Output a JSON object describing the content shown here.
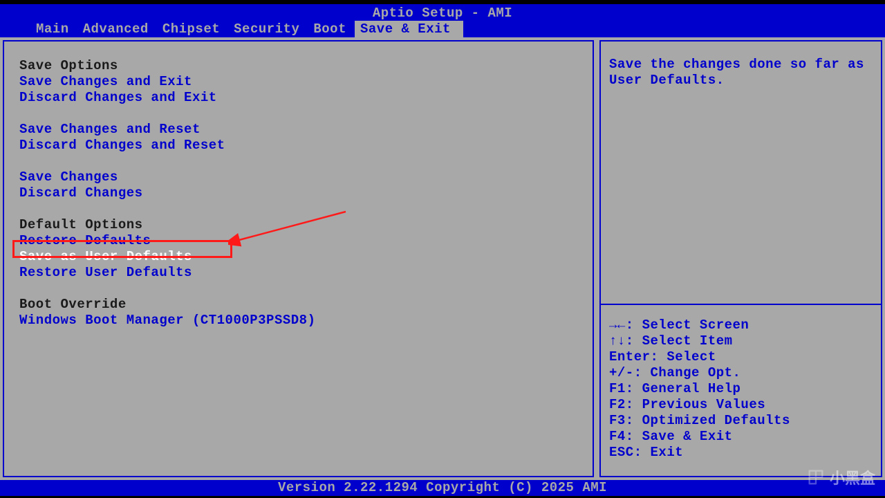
{
  "header": {
    "title": "Aptio Setup - AMI",
    "tabs": [
      "Main",
      "Advanced",
      "Chipset",
      "Security",
      "Boot",
      "Save & Exit"
    ],
    "active_tab_index": 5
  },
  "left_panel": {
    "groups": [
      {
        "heading": "Save Options",
        "items": [
          {
            "label": "Save Changes and Exit",
            "selected": false
          },
          {
            "label": "Discard Changes and Exit",
            "selected": false
          }
        ]
      },
      {
        "heading": null,
        "items": [
          {
            "label": "Save Changes and Reset",
            "selected": false
          },
          {
            "label": "Discard Changes and Reset",
            "selected": false
          }
        ]
      },
      {
        "heading": null,
        "items": [
          {
            "label": "Save Changes",
            "selected": false
          },
          {
            "label": "Discard Changes",
            "selected": false
          }
        ]
      },
      {
        "heading": "Default Options",
        "items": [
          {
            "label": "Restore Defaults",
            "selected": false
          },
          {
            "label": "Save as User Defaults",
            "selected": true
          },
          {
            "label": "Restore User Defaults",
            "selected": false
          }
        ]
      },
      {
        "heading": "Boot Override",
        "items": [
          {
            "label": "Windows Boot Manager (CT1000P3PSSD8)",
            "selected": false
          }
        ]
      }
    ]
  },
  "right_panel": {
    "help_text": "Save the changes done so far as User Defaults.",
    "legend": [
      "→←: Select Screen",
      "↑↓: Select Item",
      "Enter: Select",
      "+/-: Change Opt.",
      "F1: General Help",
      "F2: Previous Values",
      "F3: Optimized Defaults",
      "F4: Save & Exit",
      "ESC: Exit"
    ]
  },
  "footer": {
    "version": "Version 2.22.1294 Copyright (C) 2025 AMI"
  },
  "watermark": {
    "text": "小黑盒"
  }
}
